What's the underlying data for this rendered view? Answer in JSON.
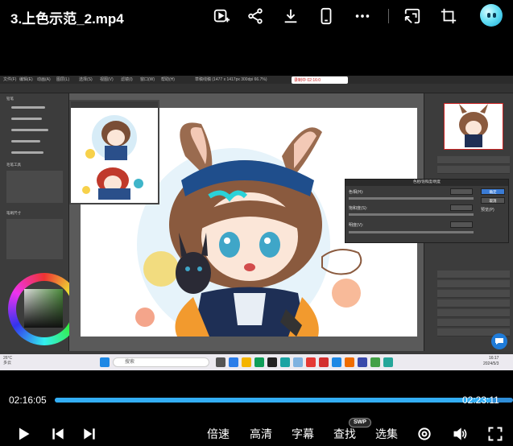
{
  "window": {
    "title": "3.上色示范_2.mp4"
  },
  "top_icons": [
    {
      "name": "picture-in-picture-icon"
    },
    {
      "name": "share-icon"
    },
    {
      "name": "download-icon"
    },
    {
      "name": "phone-icon"
    },
    {
      "name": "more-icon"
    },
    {
      "name": "cast-screen-icon"
    },
    {
      "name": "crop-icon"
    },
    {
      "name": "avatar"
    }
  ],
  "video_frame": {
    "menu_items": [
      "文件(F)",
      "编辑(E)",
      "动画(A)",
      "图层(L)",
      "选择(S)",
      "视图(V)",
      "滤镜(I)",
      "窗口(W)",
      "帮助(H)"
    ],
    "window_caption": "草稿线稿 (1477 x 1417px 300dpi 66.7%)",
    "recording_badge": "录制中 02:16:0",
    "left_panel_tabs": [
      "铅笔",
      "毛笔工具",
      "笔刷尺寸"
    ],
    "dialog": {
      "title": "色相/饱和度/明度",
      "labels": [
        "色相(H):",
        "饱和度(S):",
        "明度(V):"
      ],
      "buttons": [
        "确定",
        "取消"
      ],
      "preview_label": "预览(P)"
    },
    "taskbar": {
      "weather_temp": "26°C",
      "weather_desc": "多云",
      "search_placeholder": "搜索",
      "clock_time": "16:17",
      "clock_date": "2024/5/3"
    }
  },
  "player": {
    "current_time": "02:16:05",
    "total_time": "02:23:11",
    "progress_fraction": 0.953,
    "speed_label": "倍速",
    "quality_label": "高清",
    "subtitle_label": "字幕",
    "search_label": "查找",
    "search_badge": "SWP",
    "episodes_label": "选集"
  },
  "colors": {
    "progress_played": "#33aef5",
    "progress_track": "#2f8ed8",
    "background": "#000000"
  }
}
